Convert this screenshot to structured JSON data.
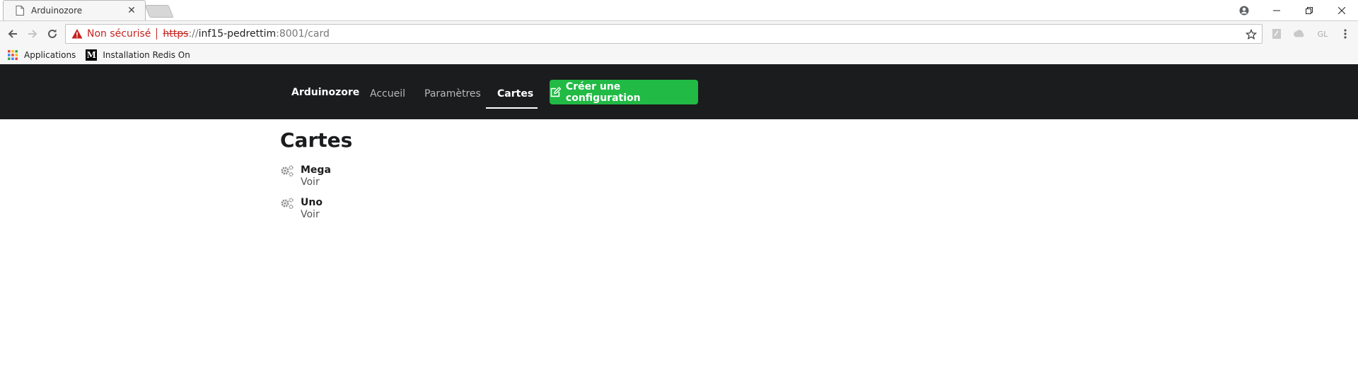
{
  "browser": {
    "tab": {
      "title": "Arduinozore"
    },
    "security": {
      "label": "Non sécurisé"
    },
    "url": {
      "scheme": "https",
      "separator": "://",
      "host": "inf15-pedrettim",
      "rest": ":8001/card"
    },
    "extensions": {
      "gl_label": "GL"
    },
    "bookmarks": [
      {
        "label": "Applications"
      },
      {
        "label": "Installation Redis On"
      }
    ]
  },
  "navbar": {
    "brand": "Arduinozore",
    "items": [
      {
        "label": "Accueil"
      },
      {
        "label": "Paramètres"
      },
      {
        "label": "Cartes"
      }
    ],
    "create_button": "Créer une configuration"
  },
  "main": {
    "title": "Cartes",
    "cards": [
      {
        "name": "Mega",
        "link": "Voir"
      },
      {
        "name": "Uno",
        "link": "Voir"
      }
    ]
  },
  "colors": {
    "navbar_bg": "#1b1c1d",
    "create_button": "#21ba45",
    "not_secure": "#c5221f"
  }
}
